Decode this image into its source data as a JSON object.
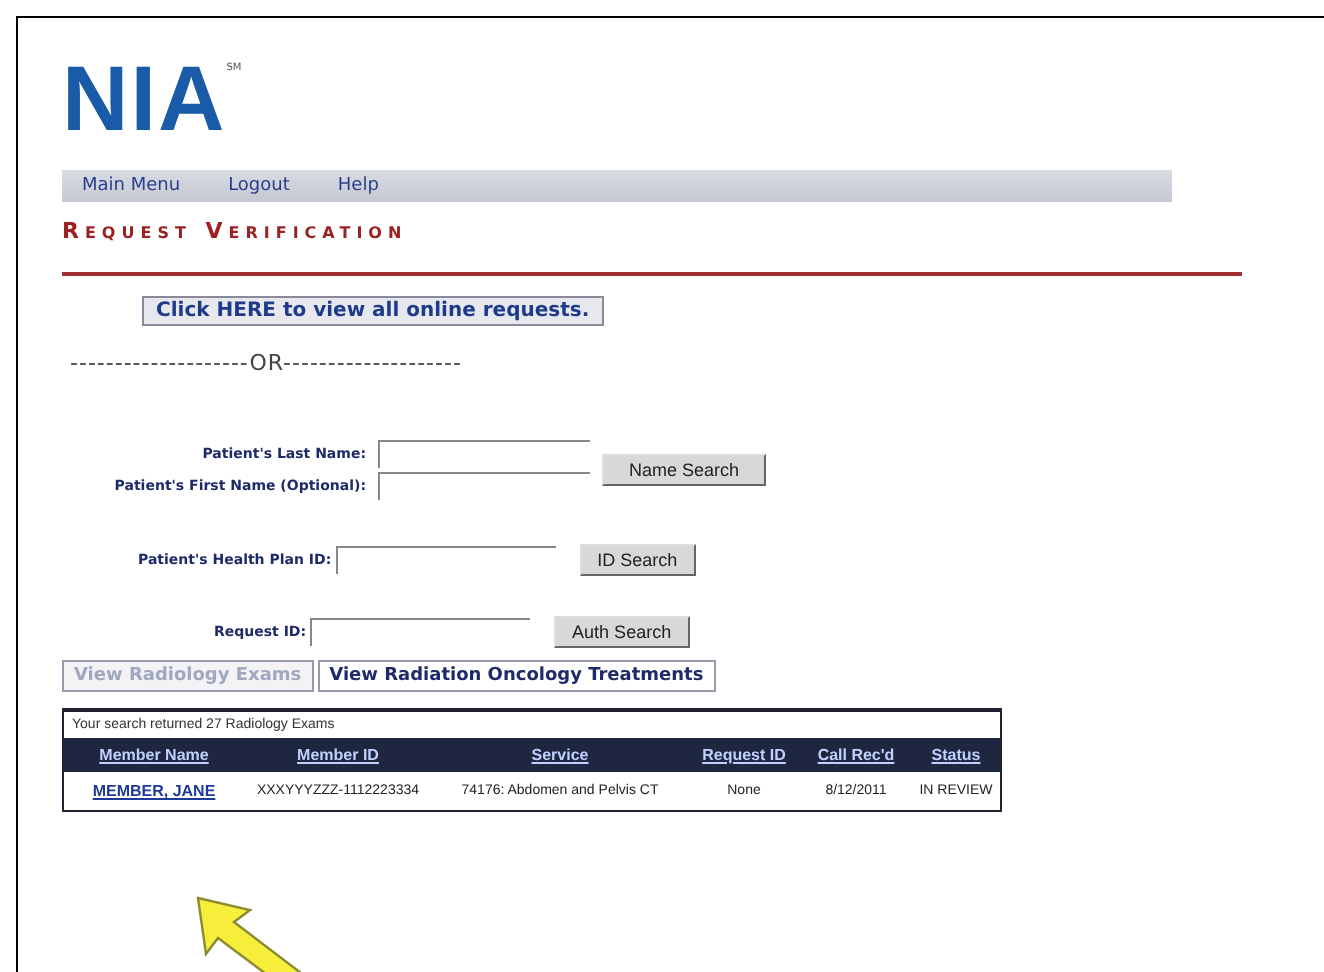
{
  "logo": {
    "text": "NIA",
    "mark": "SM"
  },
  "menu": [
    "Main Menu",
    "Logout",
    "Help"
  ],
  "title": "Request Verification",
  "view_all_button": "Click HERE to view all online requests.",
  "separator": "--------------------OR--------------------",
  "name_search": {
    "fields": [
      {
        "label": "Patient's Last Name:"
      },
      {
        "label": "Patient's First Name (Optional):"
      }
    ],
    "button": "Name Search"
  },
  "id_search": {
    "label": "Patient's Health Plan ID:",
    "button": "ID Search"
  },
  "auth_search": {
    "label": "Request ID:",
    "button": "Auth Search"
  },
  "tabs": [
    {
      "label": "View Radiology Exams",
      "selected": true
    },
    {
      "label": "View Radiation Oncology Treatments",
      "selected": false
    }
  ],
  "results": {
    "summary": "Your search returned 27 Radiology Exams",
    "columns": [
      "Member Name",
      "Member ID",
      "Service",
      "Request ID",
      "Call Rec'd",
      "Status"
    ],
    "rows": [
      [
        "MEMBER, JANE",
        "XXXYYYZZZ-1112223334",
        "74176: Abdomen and Pelvis CT",
        "None",
        "8/12/2011",
        "IN REVIEW"
      ]
    ]
  }
}
